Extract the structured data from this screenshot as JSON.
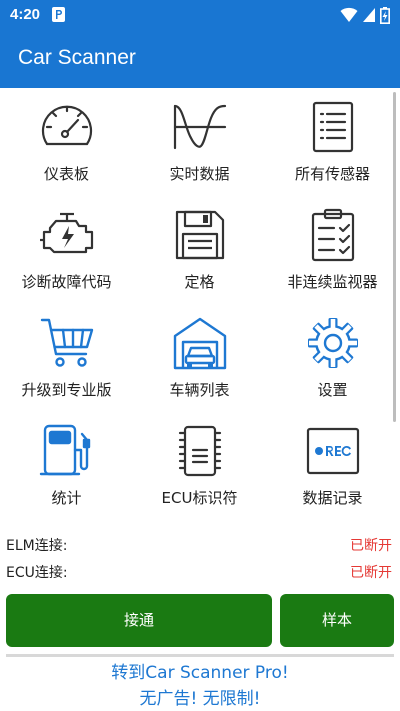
{
  "status_bar": {
    "time": "4:20"
  },
  "app_bar": {
    "title": "Car Scanner"
  },
  "menu": {
    "items": [
      {
        "label": "仪表板",
        "icon": "gauge-icon"
      },
      {
        "label": "实时数据",
        "icon": "sine-wave-icon"
      },
      {
        "label": "所有传感器",
        "icon": "list-icon"
      },
      {
        "label": "诊断故障代码",
        "icon": "engine-icon"
      },
      {
        "label": "定格",
        "icon": "floppy-disk-icon"
      },
      {
        "label": "非连续监视器",
        "icon": "clipboard-check-icon"
      },
      {
        "label": "升级到专业版",
        "icon": "shopping-cart-icon"
      },
      {
        "label": "车辆列表",
        "icon": "garage-car-icon"
      },
      {
        "label": "设置",
        "icon": "gear-icon"
      },
      {
        "label": "统计",
        "icon": "fuel-pump-icon"
      },
      {
        "label": "ECU标识符",
        "icon": "chip-icon"
      },
      {
        "label": "数据记录",
        "icon": "rec-icon"
      }
    ]
  },
  "connection": {
    "elm_label": "ELM连接:",
    "elm_status": "已断开",
    "ecu_label": "ECU连接:",
    "ecu_status": "已断开"
  },
  "buttons": {
    "connect": "接通",
    "demo": "样本"
  },
  "promo": {
    "line1": "转到Car Scanner Pro!",
    "line2": "无广告! 无限制!"
  },
  "colors": {
    "primary": "#1976d2",
    "button_green": "#1a7a12",
    "status_red": "#e53935",
    "promo_blue": "#1e78d2"
  }
}
